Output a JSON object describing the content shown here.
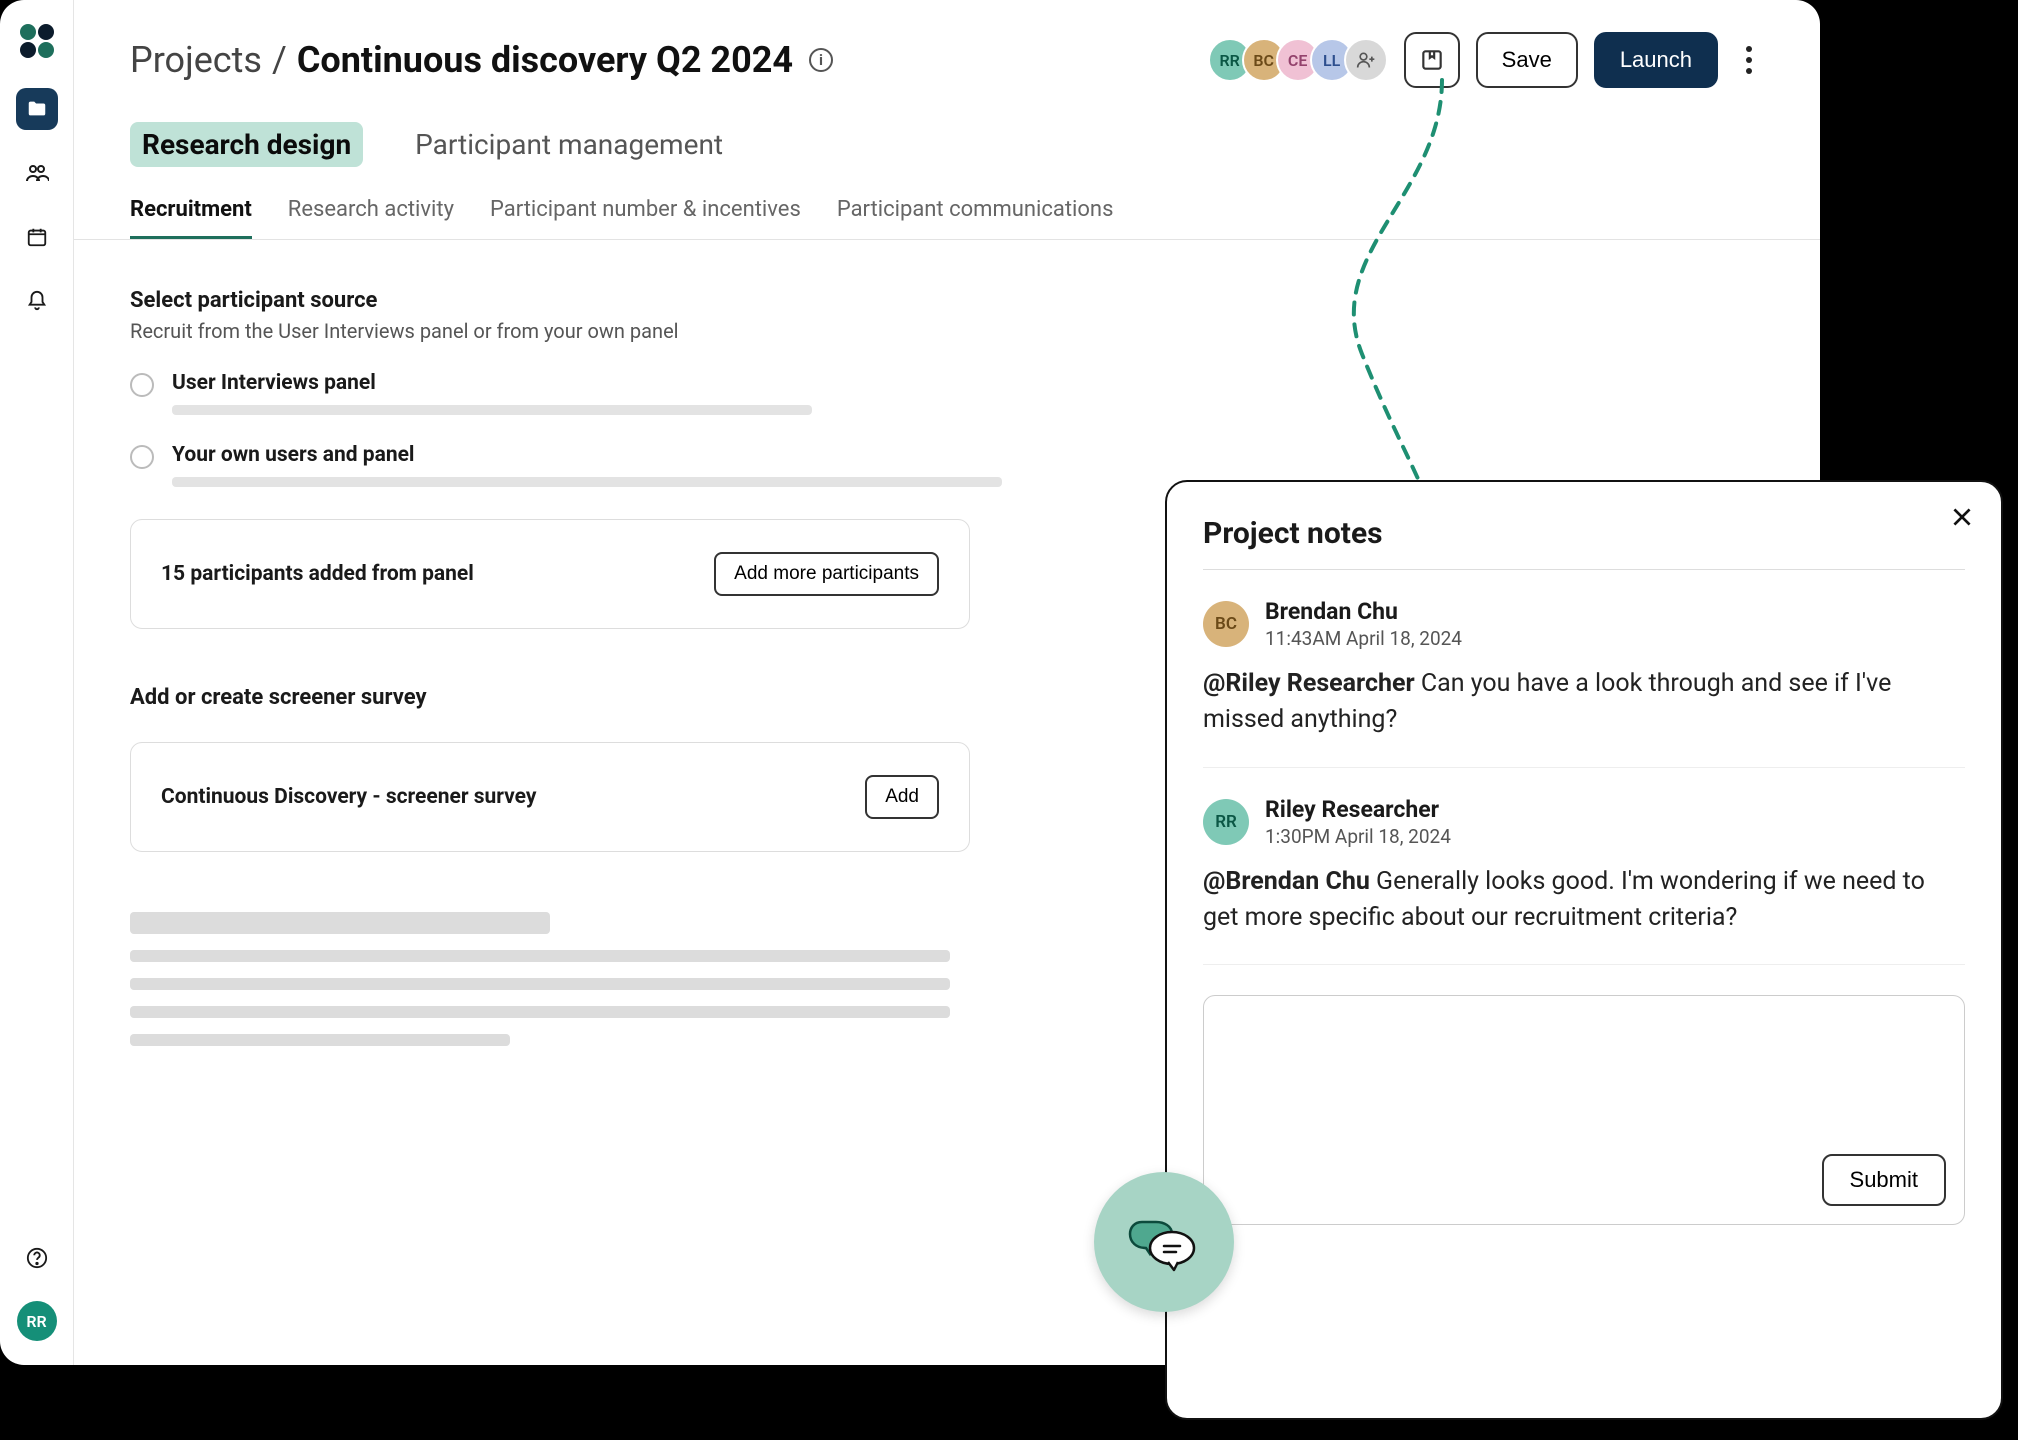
{
  "breadcrumb": {
    "parent": "Projects",
    "sep": "/",
    "current": "Continuous discovery Q2 2024"
  },
  "info_icon_label": "i",
  "avatars": [
    {
      "initials": "RR",
      "bg": "#7fc9b6",
      "fg": "#0b5745"
    },
    {
      "initials": "BC",
      "bg": "#d8b37a",
      "fg": "#6b4a18"
    },
    {
      "initials": "CE",
      "bg": "#f0c1d4",
      "fg": "#93426c"
    },
    {
      "initials": "LL",
      "bg": "#b7c7e8",
      "fg": "#2d4f8e"
    }
  ],
  "add_user_icon": "person-plus",
  "buttons": {
    "save": "Save",
    "launch": "Launch"
  },
  "mode_tabs": {
    "active": "Research design",
    "other": "Participant management"
  },
  "sub_tabs": {
    "items": [
      "Recruitment",
      "Research activity",
      "Participant number & incentives",
      "Participant communications"
    ],
    "active_index": 0
  },
  "source_section": {
    "title": "Select participant source",
    "desc": "Recruit from the User Interviews panel or from your own panel",
    "options": [
      {
        "label": "User Interviews panel"
      },
      {
        "label": "Your own users and panel"
      }
    ]
  },
  "panel_card": {
    "text": "15 participants added from panel",
    "button": "Add more participants"
  },
  "screener_section": {
    "title": "Add or create screener survey",
    "card_text": "Continuous Discovery - screener survey",
    "card_button": "Add"
  },
  "sidebar_user": "RR",
  "notes": {
    "title": "Project notes",
    "items": [
      {
        "avatar": {
          "initials": "BC",
          "bg": "#d8b37a",
          "fg": "#6b4a18"
        },
        "author": "Brendan Chu",
        "time": "11:43AM April 18, 2024",
        "mention": "@Riley Researcher",
        "body": " Can you have a look through and see if I've missed anything?"
      },
      {
        "avatar": {
          "initials": "RR",
          "bg": "#7fc9b6",
          "fg": "#0b5745"
        },
        "author": "Riley Researcher",
        "time": "1:30PM  April 18, 2024",
        "mention": "@Brendan Chu",
        "body": " Generally looks good. I'm wondering if we need to get more specific about our recruitment criteria?"
      }
    ],
    "submit": "Submit"
  }
}
